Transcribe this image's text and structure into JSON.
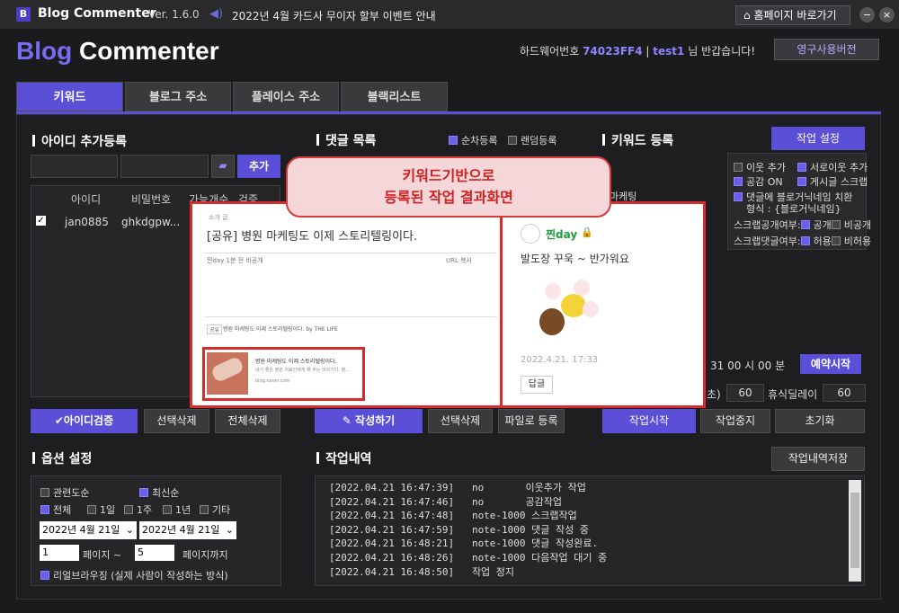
{
  "titlebar": {
    "logo_letter": "B",
    "app": "Blog Commenter",
    "version": "Ver. 1.6.0",
    "notice": "2022년 4월 카드사 무이자 할부 이벤트 안내",
    "home_btn": "홈페이지 바로가기",
    "min": "−",
    "close": "×"
  },
  "brand": {
    "blog": "Blog",
    "commenter": " Commenter"
  },
  "header": {
    "hw_label": "하드웨어번호",
    "hw_value": "74023FF4",
    "sep": "|",
    "user": "test1",
    "greeting": "님 반갑습니다!",
    "perm_btn": "영구사용버전"
  },
  "tabs": [
    "키워드",
    "블로그 주소",
    "플레이스 주소",
    "블랙리스트"
  ],
  "id_section": {
    "title": "아이디 추가등록",
    "add_btn": "추가",
    "columns": [
      "아이디",
      "비밀번호",
      "가능개수",
      "검증"
    ],
    "rows": [
      {
        "id": "jan0885",
        "pw": "ghkdgpw..."
      }
    ],
    "verify_btn": "아이디검증",
    "select_delete": "선택삭제",
    "delete_all": "전체삭제"
  },
  "comment_section": {
    "title": "댓글 목록",
    "seq": "순차등록",
    "random": "랜덤등록",
    "write_btn": "작성하기",
    "select_delete": "선택삭제",
    "file_btn": "파일로 등록"
  },
  "keyword_section": {
    "title": "키워드 등록",
    "settings_btn": "작업 설정",
    "keyword_fragment": "마케팅",
    "opts": [
      {
        "label": "이웃 추가",
        "on": false
      },
      {
        "label": "서로이웃 추가",
        "on": true
      },
      {
        "label": "공감 ON",
        "on": true
      },
      {
        "label": "게시글 스크랩",
        "on": true
      },
      {
        "label": "댓글에 블로거닉네임 치환",
        "on": true
      }
    ],
    "format": "형식 : {블로거닉네임}",
    "scrap_public_label": "스크랩공개여부:",
    "scrap_public": [
      "공개",
      "비공개"
    ],
    "scrap_comment_label": "스크랩댓글여부:",
    "scrap_comment": [
      "허용",
      "비허용"
    ],
    "schedule": "31  00  시  00  분",
    "reserve_btn": "예약시작",
    "delay_paren": "초)",
    "delay1": "60",
    "rest_delay_label": "휴식딜레이",
    "delay2": "60",
    "start_btn": "작업시작",
    "stop_btn": "작업중지",
    "reset_btn": "초기화"
  },
  "callout": {
    "line1": "키워드기반으로",
    "line2": "등록된 작업 결과화면"
  },
  "overlay": {
    "left": {
      "small": "소개 글",
      "title": "[공유] 병원 마케팅도 이제 스토리텔링이다.",
      "author": "찐day  1분 전  비공개",
      "url": "URL 복사",
      "share_label": "공유",
      "share_text": "병원 마케팅도 이제 스토리텔링이다.  by THE LIFE",
      "card_title": "병원 마케팅도 이제 스토리텔링이다.",
      "card_desc": "내가 좋은 병원 의료인에게 해 주는 이야기다. 병...",
      "card_url": "blog.naver.com"
    },
    "right": {
      "name": "찐day",
      "comment": "발도장 꾸욱 ~ 반가워요",
      "date": "2022.4.21. 17:33",
      "reply": "답글"
    }
  },
  "options": {
    "title": "옵션 설정",
    "sort": [
      {
        "label": "관련도순",
        "on": false
      },
      {
        "label": "최신순",
        "on": true
      }
    ],
    "period": [
      {
        "label": "전체",
        "on": true
      },
      {
        "label": "1일",
        "on": false
      },
      {
        "label": "1주",
        "on": false
      },
      {
        "label": "1년",
        "on": false
      },
      {
        "label": "기타",
        "on": false
      }
    ],
    "date1": "2022년   4월 21일",
    "date2": "2022년   4월 21일",
    "page_from": "1",
    "page_tilde": "페이지 ~",
    "page_to": "5",
    "page_until": "페이지까지",
    "realistic": "리얼브라우징 (실제 사람이 작성하는 방식)"
  },
  "history": {
    "title": "작업내역",
    "save_btn": "작업내역저장",
    "logs": [
      "[2022.04.21 16:47:39]   no       이웃추가 작업",
      "[2022.04.21 16:47:46]   no       공감작업",
      "[2022.04.21 16:47:48]   note-1000 스크랩작업",
      "[2022.04.21 16:47:59]   note-1000 댓글 작성 중",
      "[2022.04.21 16:48:21]   note-1000 댓글 작성완료.",
      "[2022.04.21 16:48:26]   note-1000 다음작업 대기 중",
      "[2022.04.21 16:48:50]   작업 정지"
    ]
  }
}
